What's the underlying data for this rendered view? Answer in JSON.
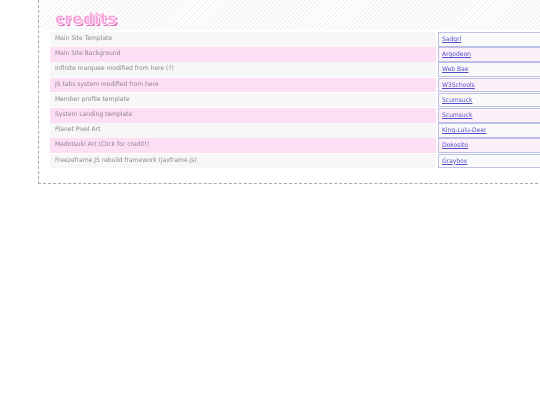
{
  "section": {
    "title": "credits"
  },
  "credits": [
    {
      "description": "Main Site Template",
      "credit": "Sadgrl"
    },
    {
      "description": "Main Site Background",
      "credit": "Argodeon"
    },
    {
      "description": "Infinite marquee modified from here (?)",
      "credit": "Web Bae"
    },
    {
      "description": "JS tabs system modified from here",
      "credit": "W3Schools"
    },
    {
      "description": "Member profile template",
      "credit": "Scumsuck"
    },
    {
      "description": "System Landing template",
      "credit": "Scumsuck"
    },
    {
      "description": "Planet Pixel Art",
      "credit": "King-Lulu-Deer"
    },
    {
      "description": "Madotsuki Art (Click for credit!)",
      "credit": "Dokosito"
    },
    {
      "description": "Freezeframe.JS rebuild framework (jaxframe.js)",
      "credit": "Graybox"
    }
  ],
  "colors": {
    "title_pink": "#f8a8de",
    "row_pink": "#fcdff2",
    "link_blue": "#4f4fc9"
  }
}
